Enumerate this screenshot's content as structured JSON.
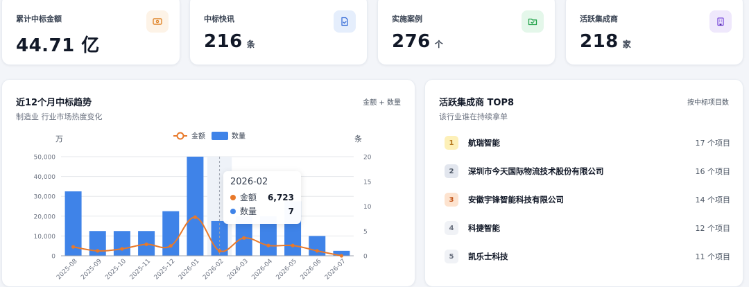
{
  "stats": [
    {
      "label": "累计中标金额",
      "value": "44.71 亿",
      "unit": "",
      "accent": "#2563eb",
      "icon": "money-icon",
      "icon_bg": "#fdf3e7",
      "icon_color": "#e0862b"
    },
    {
      "label": "中标快讯",
      "value": "216",
      "unit": "条",
      "accent": "#16a34a",
      "icon": "document-check-icon",
      "icon_bg": "#e5eefc",
      "icon_color": "#3b6fd8"
    },
    {
      "label": "实施案例",
      "value": "276",
      "unit": "个",
      "accent": "#d97706",
      "icon": "folder-check-icon",
      "icon_bg": "#e4f7ea",
      "icon_color": "#22a24a"
    },
    {
      "label": "活跃集成商",
      "value": "218",
      "unit": "家",
      "accent": "#7c3aed",
      "icon": "building-icon",
      "icon_bg": "#efe8fc",
      "icon_color": "#7c4ddb"
    }
  ],
  "trend": {
    "title": "近12个月中标趋势",
    "subtitle": "制造业 行业市场热度变化",
    "tag": "金额 + 数量"
  },
  "chart_data": {
    "type": "bar",
    "categories": [
      "2025-08",
      "2025-09",
      "2025-10",
      "2025-11",
      "2025-12",
      "2026-01",
      "2026-02",
      "2026-03",
      "2026-04",
      "2026-05",
      "2026-06",
      "2026-07"
    ],
    "series": [
      {
        "name": "金额",
        "type": "line",
        "axis": "left",
        "color": "#e8792a",
        "values": [
          4500,
          2500,
          3500,
          5800,
          5000,
          19500,
          2500,
          9000,
          5200,
          5200,
          2500,
          0
        ]
      },
      {
        "name": "数量",
        "type": "bar",
        "axis": "right",
        "color": "#3f83e8",
        "values": [
          13,
          5,
          5,
          5,
          9,
          20,
          7,
          8,
          8,
          11,
          4,
          1
        ]
      }
    ],
    "y_left": {
      "unit": "万",
      "ticks": [
        "0",
        "10,000",
        "20,000",
        "30,000",
        "40,000",
        "50,000"
      ],
      "ylim": [
        0,
        50000
      ]
    },
    "y_right": {
      "unit": "条",
      "ticks": [
        "0",
        "5",
        "10",
        "15",
        "20"
      ],
      "ylim": [
        0,
        20
      ]
    },
    "legend_position": "top-center",
    "grid": true
  },
  "tooltip": {
    "title": "2026-02",
    "rows": [
      {
        "name": "金额",
        "value": "6,723",
        "color": "#e8792a"
      },
      {
        "name": "数量",
        "value": "7",
        "color": "#3f83e8"
      }
    ]
  },
  "top": {
    "title": "活跃集成商 TOP8",
    "subtitle": "该行业谁在持续拿单",
    "tag": "按中标项目数",
    "items": [
      {
        "rank": "1",
        "name": "航瑞智能",
        "count": "17 个项目",
        "badge_bg": "#fdf0b8",
        "badge_color": "#b7791f"
      },
      {
        "rank": "2",
        "name": "深圳市今天国际物流技术股份有限公司",
        "count": "16 个项目",
        "badge_bg": "#e2e6ee",
        "badge_color": "#4b5563"
      },
      {
        "rank": "3",
        "name": "安徽宇锋智能科技有限公司",
        "count": "14 个项目",
        "badge_bg": "#fde3cf",
        "badge_color": "#c2561a"
      },
      {
        "rank": "4",
        "name": "科捷智能",
        "count": "12 个项目",
        "badge_bg": "#f0f2f6",
        "badge_color": "#6b7280"
      },
      {
        "rank": "5",
        "name": "凯乐士科技",
        "count": "11 个项目",
        "badge_bg": "#f0f2f6",
        "badge_color": "#6b7280"
      }
    ]
  }
}
